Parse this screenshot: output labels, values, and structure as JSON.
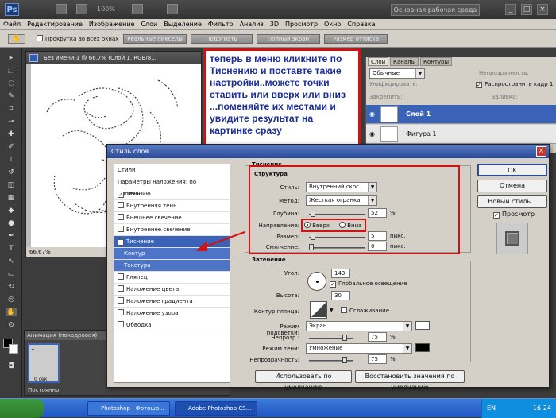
{
  "app": {
    "zoom": "100%",
    "workspace": "Основная рабочая среда",
    "logo": "Ps"
  },
  "menu": [
    "Файл",
    "Редактирование",
    "Изображение",
    "Слои",
    "Выделение",
    "Фильтр",
    "Анализ",
    "3D",
    "Просмотр",
    "Окно",
    "Справка"
  ],
  "options": {
    "snap_all": "Прокрутка во всех окнах",
    "b1": "Реальные пикселы",
    "b2": "Подогнать",
    "b3": "Полный экран",
    "b4": "Размер оттиска"
  },
  "document": {
    "title": "Без имени-1 @ 66,7% (Слой 1, RGB/8...",
    "zoom": "66,67%"
  },
  "annotation": "теперь в меню кликните по Тиснению и поставте такие настройки..можете точки ставить или вверх или вниз ...поменяйте их местами и увидите результат на картинке сразу",
  "layers": {
    "tabs": [
      "Слои",
      "Каналы",
      "Контуры"
    ],
    "blend": "Обычные",
    "opacity_label": "Непрозрачность:",
    "lock_label": "Закрепить:",
    "fill_label": "Заливка:",
    "unify": "Унифицировать:",
    "spread": "Распространить кадр 1",
    "rows": [
      "Слой 1",
      "Фигура 1"
    ]
  },
  "animation": {
    "title": "Анимация (покадровая)",
    "frame": "1",
    "time": "0 сек.",
    "loop": "Постоянно"
  },
  "dialog": {
    "title": "Стиль слоя",
    "list": [
      {
        "label": "Стили",
        "kind": "head"
      },
      {
        "label": "Параметры наложения: по умолчанию",
        "kind": "head"
      },
      {
        "label": "Тень",
        "checked": "✓"
      },
      {
        "label": "Внутренняя тень",
        "checked": ""
      },
      {
        "label": "Внешнее свечение",
        "checked": ""
      },
      {
        "label": "Внутреннее свечение",
        "checked": ""
      },
      {
        "label": "Тиснение",
        "checked": "✓",
        "kind": "sel"
      },
      {
        "label": "Контур",
        "kind": "sub"
      },
      {
        "label": "Текстура",
        "kind": "sub"
      },
      {
        "label": "Глянец",
        "checked": ""
      },
      {
        "label": "Наложение цвета",
        "checked": ""
      },
      {
        "label": "Наложение градиента",
        "checked": ""
      },
      {
        "label": "Наложение узора",
        "checked": ""
      },
      {
        "label": "Обводка",
        "checked": ""
      }
    ],
    "section": "Тиснение",
    "structure": "Структура",
    "style_label": "Стиль:",
    "style_value": "Внутренний скос",
    "method_label": "Метод:",
    "method_value": "Жесткая огранка",
    "depth_label": "Глубина:",
    "depth_value": "52",
    "dir_label": "Направление:",
    "dir_up": "Вверх",
    "dir_down": "Вниз",
    "size_label": "Размер:",
    "size_value": "5",
    "soft_label": "Смягчение:",
    "soft_value": "0",
    "unit_px": "пикс.",
    "unit_pct": "%",
    "shading": "Затенение",
    "angle_label": "Угол:",
    "angle_value": "143",
    "global_light": "Глобальное освещение",
    "altitude_label": "Высота:",
    "altitude_value": "30",
    "gloss_label": "Контур глянца:",
    "antialias": "Сглаживание",
    "hl_label": "Режим подсветки:",
    "hl_value": "Экран",
    "op1_label": "Непрозр.:",
    "op1_value": "75",
    "sh_label": "Режим тени:",
    "sh_value": "Умножение",
    "op2_label": "Непрозрачность:",
    "op2_value": "75",
    "default_btn": "Использовать по умолчанию",
    "reset_btn": "Восстановить значения по умолчанию",
    "ok": "OK",
    "cancel": "Отмена",
    "new_style": "Новый стиль...",
    "preview": "Просмотр"
  },
  "taskbar": {
    "t1": "Photoshop - Фотошо...",
    "t2": "Adobe Photoshop CS...",
    "lang": "EN",
    "time": "16:24"
  }
}
